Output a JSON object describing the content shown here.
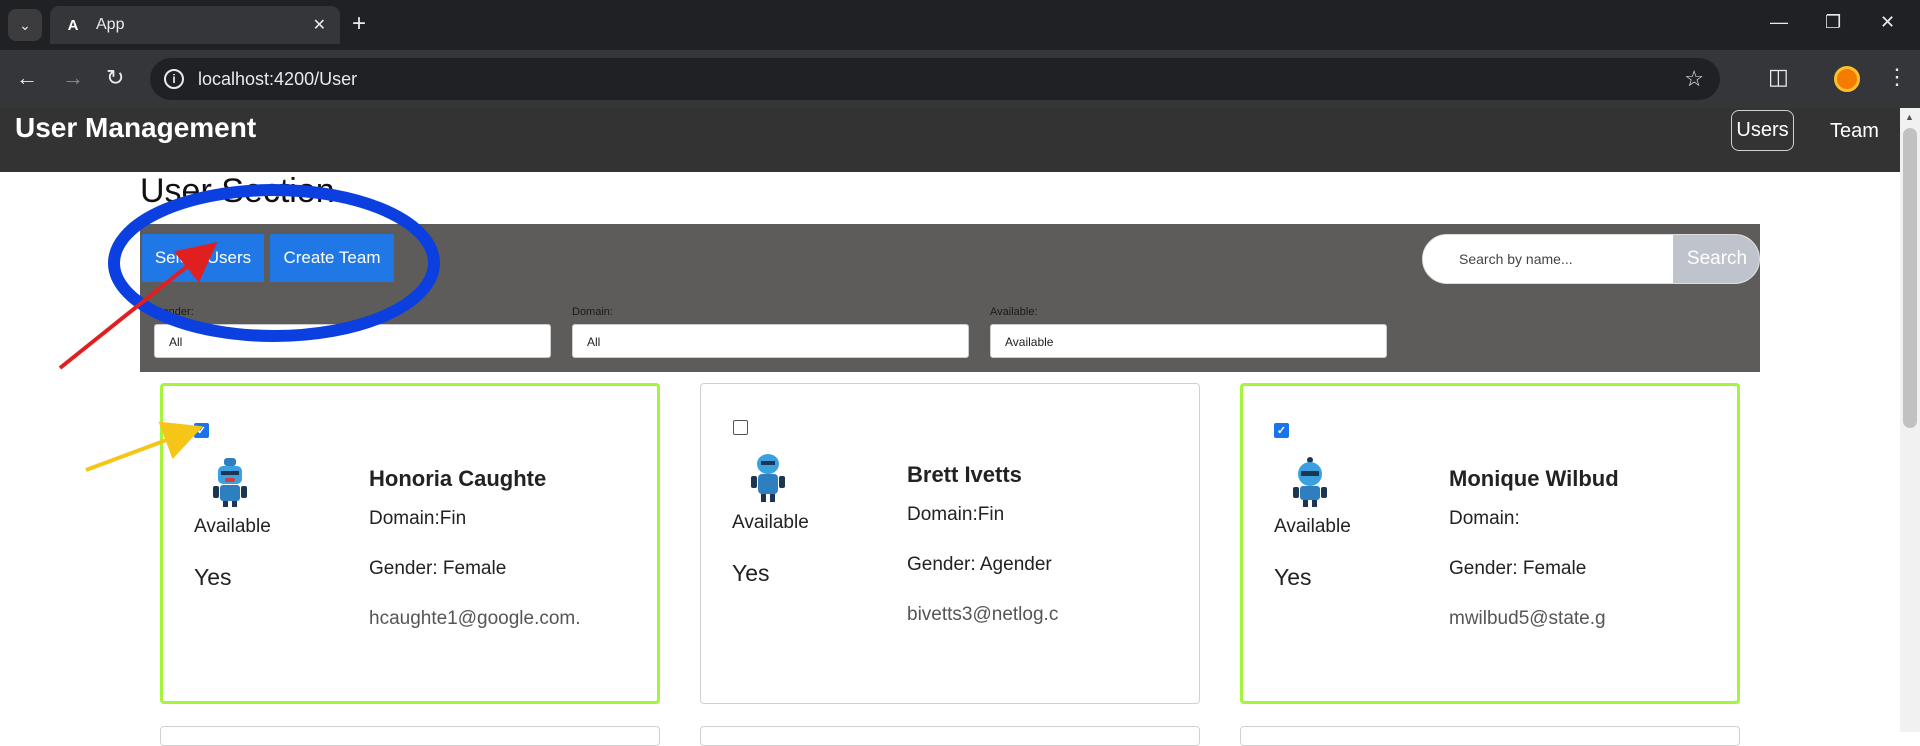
{
  "browser": {
    "tab_title": "App",
    "url": "localhost:4200/User"
  },
  "header": {
    "title": "User Management",
    "nav_users": "Users",
    "nav_team": "Team"
  },
  "section": {
    "title": "User Section",
    "select_users_label": "Select Users",
    "create_team_label": "Create Team",
    "search_placeholder": "Search by name...",
    "search_button": "Search",
    "filters": [
      {
        "label": "Gender:",
        "value": "All"
      },
      {
        "label": "Domain:",
        "value": "All"
      },
      {
        "label": "Available:",
        "value": "Available"
      }
    ]
  },
  "cards": [
    {
      "name": "Honoria Caughte",
      "domain": "Domain:Fin",
      "gender": "Gender: Female",
      "email": "hcaughte1@google.com.",
      "available_label": "Available",
      "available_value": "Yes",
      "checked": true
    },
    {
      "name": "Brett Ivetts",
      "domain": "Domain:Fin",
      "gender": "Gender: Agender",
      "email": "bivetts3@netlog.c",
      "available_label": "Available",
      "available_value": "Yes",
      "checked": false
    },
    {
      "name": "Monique Wilbud",
      "domain": "Domain:",
      "gender": "Gender: Female",
      "email": "mwilbud5@state.g",
      "available_label": "Available",
      "available_value": "Yes",
      "checked": true
    }
  ],
  "annotations": {
    "circle_color": "#0b3fe0",
    "red_arrow_color": "#e02020",
    "yellow_arrow_color": "#f5c518"
  },
  "colors": {
    "accent_button": "#1f78e6",
    "selected_border": "#a4f53c",
    "header_bg": "#333333",
    "toolbar_bg": "#5d5c5a"
  }
}
